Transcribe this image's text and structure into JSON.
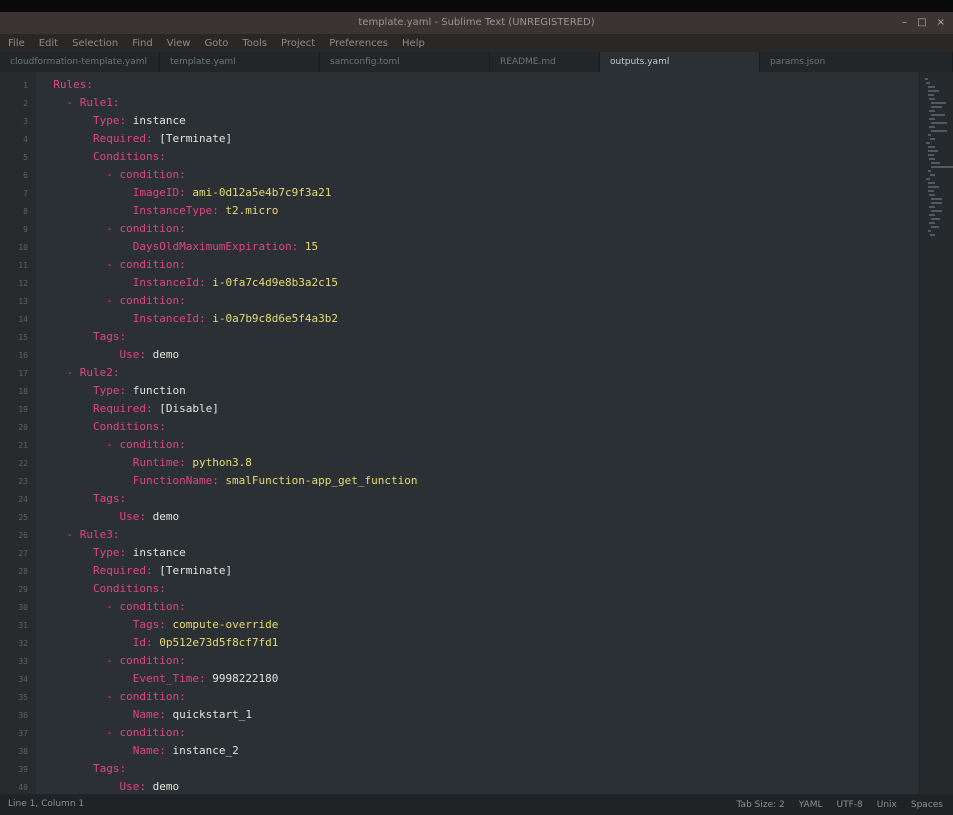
{
  "app": {
    "title": "template.yaml - Sublime Text (UNREGISTERED)",
    "window_controls": [
      "–",
      "□",
      "×"
    ]
  },
  "menu": [
    "File",
    "Edit",
    "Selection",
    "Find",
    "View",
    "Goto",
    "Tools",
    "Project",
    "Preferences",
    "Help"
  ],
  "tabs": [
    {
      "label": "cloudformation-template.yaml"
    },
    {
      "label": "template.yaml"
    },
    {
      "label": "samconfig.toml"
    },
    {
      "label": "README.md"
    },
    {
      "label": "outputs.yaml"
    },
    {
      "label": "params.json"
    }
  ],
  "active_tab_index": 4,
  "code_lines": [
    [
      {
        "t": "  ",
        "c": "p"
      },
      {
        "t": "Rules:",
        "c": "k"
      }
    ],
    [
      {
        "t": "    ",
        "c": "p"
      },
      {
        "t": "- Rule1:",
        "c": "k"
      }
    ],
    [
      {
        "t": "        ",
        "c": "p"
      },
      {
        "t": "Type:",
        "c": "k"
      },
      {
        "t": " instance",
        "c": "v"
      }
    ],
    [
      {
        "t": "        ",
        "c": "p"
      },
      {
        "t": "Required:",
        "c": "k"
      },
      {
        "t": " [Terminate]",
        "c": "v"
      }
    ],
    [
      {
        "t": "        ",
        "c": "p"
      },
      {
        "t": "Conditions:",
        "c": "k"
      }
    ],
    [
      {
        "t": "          ",
        "c": "p"
      },
      {
        "t": "- condition:",
        "c": "k"
      }
    ],
    [
      {
        "t": "              ",
        "c": "p"
      },
      {
        "t": "ImageID:",
        "c": "k"
      },
      {
        "t": " ami-0d12a5e4b7c9f3a21",
        "c": "s"
      }
    ],
    [
      {
        "t": "              ",
        "c": "p"
      },
      {
        "t": "InstanceType:",
        "c": "k"
      },
      {
        "t": " t2.micro",
        "c": "s"
      }
    ],
    [
      {
        "t": "          ",
        "c": "p"
      },
      {
        "t": "- condition:",
        "c": "k"
      }
    ],
    [
      {
        "t": "              ",
        "c": "p"
      },
      {
        "t": "DaysOldMaximumExpiration:",
        "c": "k"
      },
      {
        "t": " 15",
        "c": "s"
      }
    ],
    [
      {
        "t": "          ",
        "c": "p"
      },
      {
        "t": "- condition:",
        "c": "k"
      }
    ],
    [
      {
        "t": "              ",
        "c": "p"
      },
      {
        "t": "InstanceId:",
        "c": "k"
      },
      {
        "t": " i-0fa7c4d9e8b3a2c15",
        "c": "s"
      }
    ],
    [
      {
        "t": "          ",
        "c": "p"
      },
      {
        "t": "- condition:",
        "c": "k"
      }
    ],
    [
      {
        "t": "              ",
        "c": "p"
      },
      {
        "t": "InstanceId:",
        "c": "k"
      },
      {
        "t": " i-0a7b9c8d6e5f4a3b2",
        "c": "s"
      }
    ],
    [
      {
        "t": "        ",
        "c": "p"
      },
      {
        "t": "Tags:",
        "c": "k"
      }
    ],
    [
      {
        "t": "            ",
        "c": "p"
      },
      {
        "t": "Use:",
        "c": "k"
      },
      {
        "t": " demo",
        "c": "v"
      }
    ],
    [
      {
        "t": "    ",
        "c": "p"
      },
      {
        "t": "- Rule2:",
        "c": "k"
      }
    ],
    [
      {
        "t": "        ",
        "c": "p"
      },
      {
        "t": "Type:",
        "c": "k"
      },
      {
        "t": " function",
        "c": "v"
      }
    ],
    [
      {
        "t": "        ",
        "c": "p"
      },
      {
        "t": "Required:",
        "c": "k"
      },
      {
        "t": " [Disable]",
        "c": "v"
      }
    ],
    [
      {
        "t": "        ",
        "c": "p"
      },
      {
        "t": "Conditions:",
        "c": "k"
      }
    ],
    [
      {
        "t": "          ",
        "c": "p"
      },
      {
        "t": "- condition:",
        "c": "k"
      }
    ],
    [
      {
        "t": "              ",
        "c": "p"
      },
      {
        "t": "Runtime:",
        "c": "k"
      },
      {
        "t": " python3.8",
        "c": "s"
      }
    ],
    [
      {
        "t": "              ",
        "c": "p"
      },
      {
        "t": "FunctionName:",
        "c": "k"
      },
      {
        "t": " smalFunction-app_get_function",
        "c": "s"
      }
    ],
    [
      {
        "t": "        ",
        "c": "p"
      },
      {
        "t": "Tags:",
        "c": "k"
      }
    ],
    [
      {
        "t": "            ",
        "c": "p"
      },
      {
        "t": "Use:",
        "c": "k"
      },
      {
        "t": " demo",
        "c": "v"
      }
    ],
    [
      {
        "t": "    ",
        "c": "p"
      },
      {
        "t": "- Rule3:",
        "c": "k"
      }
    ],
    [
      {
        "t": "        ",
        "c": "p"
      },
      {
        "t": "Type:",
        "c": "k"
      },
      {
        "t": " instance",
        "c": "v"
      }
    ],
    [
      {
        "t": "        ",
        "c": "p"
      },
      {
        "t": "Required:",
        "c": "k"
      },
      {
        "t": " [Terminate]",
        "c": "v"
      }
    ],
    [
      {
        "t": "        ",
        "c": "p"
      },
      {
        "t": "Conditions:",
        "c": "k"
      }
    ],
    [
      {
        "t": "          ",
        "c": "p"
      },
      {
        "t": "- condition:",
        "c": "k"
      }
    ],
    [
      {
        "t": "              ",
        "c": "p"
      },
      {
        "t": "Tags:",
        "c": "k"
      },
      {
        "t": " compute-override",
        "c": "s"
      }
    ],
    [
      {
        "t": "              ",
        "c": "p"
      },
      {
        "t": "Id:",
        "c": "k"
      },
      {
        "t": " 0p512e73d5f8cf7fd1",
        "c": "s"
      }
    ],
    [
      {
        "t": "          ",
        "c": "p"
      },
      {
        "t": "- condition:",
        "c": "k"
      }
    ],
    [
      {
        "t": "              ",
        "c": "p"
      },
      {
        "t": "Event_Time:",
        "c": "k"
      },
      {
        "t": " 9998222180",
        "c": "v"
      }
    ],
    [
      {
        "t": "          ",
        "c": "p"
      },
      {
        "t": "- condition:",
        "c": "k"
      }
    ],
    [
      {
        "t": "              ",
        "c": "p"
      },
      {
        "t": "Name:",
        "c": "k"
      },
      {
        "t": " quickstart_1",
        "c": "v"
      }
    ],
    [
      {
        "t": "          ",
        "c": "p"
      },
      {
        "t": "- condition:",
        "c": "k"
      }
    ],
    [
      {
        "t": "              ",
        "c": "p"
      },
      {
        "t": "Name:",
        "c": "k"
      },
      {
        "t": " instance_2",
        "c": "v"
      }
    ],
    [
      {
        "t": "        ",
        "c": "p"
      },
      {
        "t": "Tags:",
        "c": "k"
      }
    ],
    [
      {
        "t": "            ",
        "c": "p"
      },
      {
        "t": "Use:",
        "c": "k"
      },
      {
        "t": " demo",
        "c": "v"
      }
    ]
  ],
  "line_numbers_start": 1,
  "status": {
    "left": "Line 1, Column 1",
    "right": [
      "Tab Size: 2",
      "YAML",
      "UTF-8",
      "Unix",
      "Spaces"
    ]
  },
  "colors": {
    "key": "#e0467c",
    "value": "#e4e4dc",
    "string": "#e6db74",
    "background": "#2b3034"
  }
}
